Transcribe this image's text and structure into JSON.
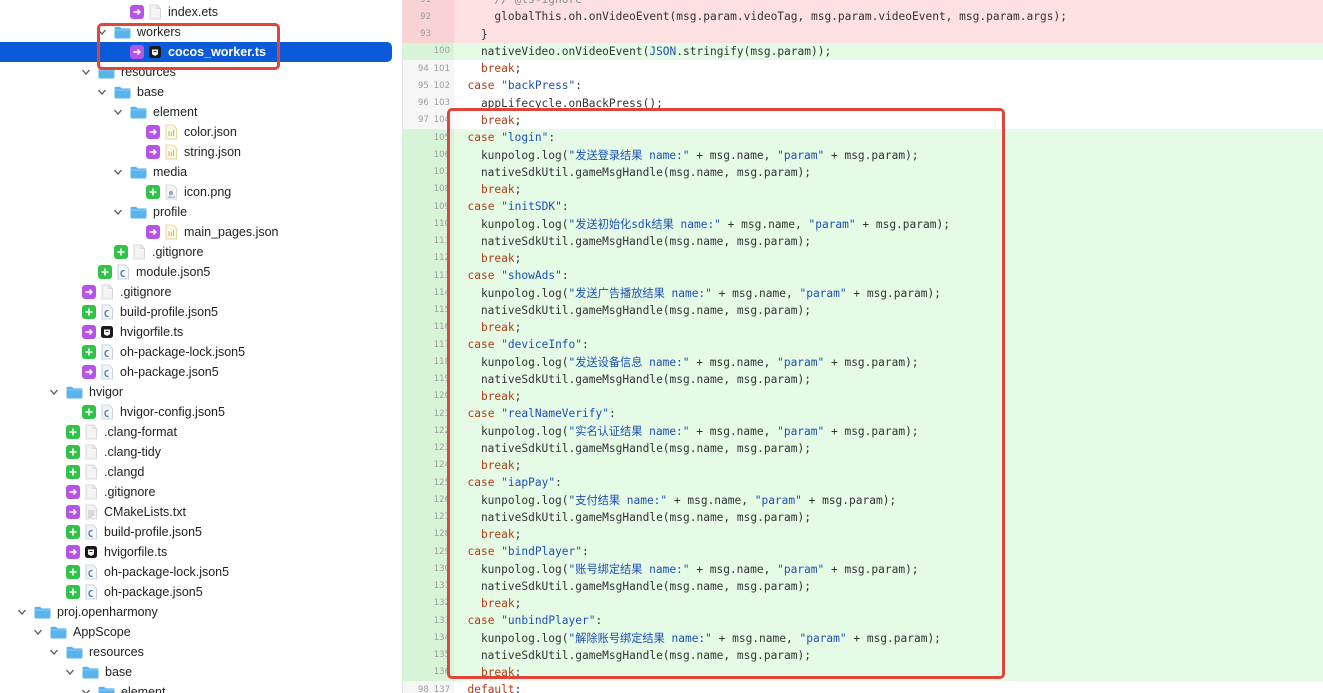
{
  "tree": [
    {
      "indent": 6,
      "chevron": "none",
      "badge": "mod",
      "icon": "file",
      "label": "index.ets"
    },
    {
      "indent": 5,
      "chevron": "open",
      "badge": "none",
      "icon": "folder",
      "label": "workers"
    },
    {
      "indent": 6,
      "chevron": "none",
      "badge": "mod",
      "icon": "ts-dark",
      "label": "cocos_worker.ts",
      "selected": true
    },
    {
      "indent": 4,
      "chevron": "open",
      "badge": "none",
      "icon": "folder",
      "label": "resources"
    },
    {
      "indent": 5,
      "chevron": "open",
      "badge": "none",
      "icon": "folder",
      "label": "base"
    },
    {
      "indent": 6,
      "chevron": "open",
      "badge": "none",
      "icon": "folder",
      "label": "element"
    },
    {
      "indent": 7,
      "chevron": "none",
      "badge": "mod",
      "icon": "json",
      "label": "color.json"
    },
    {
      "indent": 7,
      "chevron": "none",
      "badge": "mod",
      "icon": "json",
      "label": "string.json"
    },
    {
      "indent": 6,
      "chevron": "open",
      "badge": "none",
      "icon": "folder",
      "label": "media"
    },
    {
      "indent": 7,
      "chevron": "none",
      "badge": "add",
      "icon": "png",
      "label": "icon.png"
    },
    {
      "indent": 6,
      "chevron": "open",
      "badge": "none",
      "icon": "folder",
      "label": "profile"
    },
    {
      "indent": 7,
      "chevron": "none",
      "badge": "mod",
      "icon": "json",
      "label": "main_pages.json"
    },
    {
      "indent": 5,
      "chevron": "none",
      "badge": "add",
      "icon": "file",
      "label": ".gitignore"
    },
    {
      "indent": 4,
      "chevron": "none",
      "badge": "add",
      "icon": "json5",
      "label": "module.json5"
    },
    {
      "indent": 3,
      "chevron": "none",
      "badge": "mod",
      "icon": "file",
      "label": ".gitignore"
    },
    {
      "indent": 3,
      "chevron": "none",
      "badge": "add",
      "icon": "json5",
      "label": "build-profile.json5"
    },
    {
      "indent": 3,
      "chevron": "none",
      "badge": "mod",
      "icon": "ts-dark",
      "label": "hvigorfile.ts"
    },
    {
      "indent": 3,
      "chevron": "none",
      "badge": "add",
      "icon": "json5",
      "label": "oh-package-lock.json5"
    },
    {
      "indent": 3,
      "chevron": "none",
      "badge": "mod",
      "icon": "json5",
      "label": "oh-package.json5"
    },
    {
      "indent": 2,
      "chevron": "open",
      "badge": "none",
      "icon": "folder",
      "label": "hvigor"
    },
    {
      "indent": 3,
      "chevron": "none",
      "badge": "add",
      "icon": "json5",
      "label": "hvigor-config.json5"
    },
    {
      "indent": 2,
      "chevron": "none",
      "badge": "add",
      "icon": "file",
      "label": ".clang-format"
    },
    {
      "indent": 2,
      "chevron": "none",
      "badge": "add",
      "icon": "file",
      "label": ".clang-tidy"
    },
    {
      "indent": 2,
      "chevron": "none",
      "badge": "add",
      "icon": "file",
      "label": ".clangd"
    },
    {
      "indent": 2,
      "chevron": "none",
      "badge": "mod",
      "icon": "file",
      "label": ".gitignore"
    },
    {
      "indent": 2,
      "chevron": "none",
      "badge": "mod",
      "icon": "txt",
      "label": "CMakeLists.txt"
    },
    {
      "indent": 2,
      "chevron": "none",
      "badge": "add",
      "icon": "json5",
      "label": "build-profile.json5"
    },
    {
      "indent": 2,
      "chevron": "none",
      "badge": "mod",
      "icon": "ts-dark",
      "label": "hvigorfile.ts"
    },
    {
      "indent": 2,
      "chevron": "none",
      "badge": "add",
      "icon": "json5",
      "label": "oh-package-lock.json5"
    },
    {
      "indent": 2,
      "chevron": "none",
      "badge": "add",
      "icon": "json5",
      "label": "oh-package.json5"
    },
    {
      "indent": 0,
      "chevron": "open",
      "badge": "none",
      "icon": "folder",
      "label": "proj.openharmony"
    },
    {
      "indent": 1,
      "chevron": "open",
      "badge": "none",
      "icon": "folder",
      "label": "AppScope"
    },
    {
      "indent": 2,
      "chevron": "open",
      "badge": "none",
      "icon": "folder",
      "label": "resources"
    },
    {
      "indent": 3,
      "chevron": "open",
      "badge": "none",
      "icon": "folder",
      "label": "base"
    },
    {
      "indent": 4,
      "chevron": "open",
      "badge": "none",
      "icon": "folder",
      "label": "element"
    }
  ],
  "code": [
    {
      "type": "del",
      "old": "91",
      "new": "",
      "tokens": [
        [
          "      ",
          ""
        ],
        [
          "// @ts-ignore",
          "cm"
        ]
      ]
    },
    {
      "type": "del",
      "old": "92",
      "new": "",
      "tokens": [
        [
          "      globalThis.oh.onVideoEvent(msg.param.videoTag, msg.param.videoEvent, msg.param.args);",
          ""
        ]
      ]
    },
    {
      "type": "del",
      "old": "93",
      "new": "",
      "tokens": [
        [
          "    }",
          ""
        ]
      ]
    },
    {
      "type": "add",
      "old": "",
      "new": "100",
      "tokens": [
        [
          "    nativeVideo.onVideoEvent(",
          ""
        ],
        [
          "JSON",
          "blue"
        ],
        [
          ".stringify(msg.param));",
          ""
        ]
      ]
    },
    {
      "type": "ctx",
      "old": "94",
      "new": "101",
      "tokens": [
        [
          "    ",
          ""
        ],
        [
          "break",
          "kw"
        ],
        [
          ";",
          ""
        ]
      ]
    },
    {
      "type": "ctx",
      "old": "95",
      "new": "102",
      "tokens": [
        [
          "  ",
          ""
        ],
        [
          "case",
          "kw"
        ],
        [
          " ",
          ""
        ],
        [
          "\"backPress\"",
          "str"
        ],
        [
          ":",
          ""
        ]
      ]
    },
    {
      "type": "ctx",
      "old": "96",
      "new": "103",
      "tokens": [
        [
          "    appLifecycle.onBackPress();",
          ""
        ]
      ]
    },
    {
      "type": "ctx",
      "old": "97",
      "new": "104",
      "tokens": [
        [
          "    ",
          ""
        ],
        [
          "break",
          "kw"
        ],
        [
          ";",
          ""
        ]
      ]
    },
    {
      "type": "add",
      "old": "",
      "new": "105",
      "tokens": [
        [
          "  ",
          ""
        ],
        [
          "case",
          "kw"
        ],
        [
          " ",
          ""
        ],
        [
          "\"login\"",
          "str"
        ],
        [
          ":",
          ""
        ]
      ]
    },
    {
      "type": "add",
      "old": "",
      "new": "106",
      "tokens": [
        [
          "    kunpolog.log(",
          ""
        ],
        [
          "\"发送登录结果 name:\"",
          "str"
        ],
        [
          " + msg.name, ",
          ""
        ],
        [
          "\"param\"",
          "str"
        ],
        [
          " + msg.param);",
          ""
        ]
      ]
    },
    {
      "type": "add",
      "old": "",
      "new": "107",
      "tokens": [
        [
          "    nativeSdkUtil.gameMsgHandle(msg.name, msg.param);",
          ""
        ]
      ]
    },
    {
      "type": "add",
      "old": "",
      "new": "108",
      "tokens": [
        [
          "    ",
          ""
        ],
        [
          "break",
          "kw"
        ],
        [
          ";",
          ""
        ]
      ]
    },
    {
      "type": "add",
      "old": "",
      "new": "109",
      "tokens": [
        [
          "  ",
          ""
        ],
        [
          "case",
          "kw"
        ],
        [
          " ",
          ""
        ],
        [
          "\"initSDK\"",
          "str"
        ],
        [
          ":",
          ""
        ]
      ]
    },
    {
      "type": "add",
      "old": "",
      "new": "110",
      "tokens": [
        [
          "    kunpolog.log(",
          ""
        ],
        [
          "\"发送初始化sdk结果 name:\"",
          "str"
        ],
        [
          " + msg.name, ",
          ""
        ],
        [
          "\"param\"",
          "str"
        ],
        [
          " + msg.param);",
          ""
        ]
      ]
    },
    {
      "type": "add",
      "old": "",
      "new": "111",
      "tokens": [
        [
          "    nativeSdkUtil.gameMsgHandle(msg.name, msg.param);",
          ""
        ]
      ]
    },
    {
      "type": "add",
      "old": "",
      "new": "112",
      "tokens": [
        [
          "    ",
          ""
        ],
        [
          "break",
          "kw"
        ],
        [
          ";",
          ""
        ]
      ]
    },
    {
      "type": "add",
      "old": "",
      "new": "113",
      "tokens": [
        [
          "  ",
          ""
        ],
        [
          "case",
          "kw"
        ],
        [
          " ",
          ""
        ],
        [
          "\"showAds\"",
          "str"
        ],
        [
          ":",
          ""
        ]
      ]
    },
    {
      "type": "add",
      "old": "",
      "new": "114",
      "tokens": [
        [
          "    kunpolog.log(",
          ""
        ],
        [
          "\"发送广告播放结果 name:\"",
          "str"
        ],
        [
          " + msg.name, ",
          ""
        ],
        [
          "\"param\"",
          "str"
        ],
        [
          " + msg.param);",
          ""
        ]
      ]
    },
    {
      "type": "add",
      "old": "",
      "new": "115",
      "tokens": [
        [
          "    nativeSdkUtil.gameMsgHandle(msg.name, msg.param);",
          ""
        ]
      ]
    },
    {
      "type": "add",
      "old": "",
      "new": "116",
      "tokens": [
        [
          "    ",
          ""
        ],
        [
          "break",
          "kw"
        ],
        [
          ";",
          ""
        ]
      ]
    },
    {
      "type": "add",
      "old": "",
      "new": "117",
      "tokens": [
        [
          "  ",
          ""
        ],
        [
          "case",
          "kw"
        ],
        [
          " ",
          ""
        ],
        [
          "\"deviceInfo\"",
          "str"
        ],
        [
          ":",
          ""
        ]
      ]
    },
    {
      "type": "add",
      "old": "",
      "new": "118",
      "tokens": [
        [
          "    kunpolog.log(",
          ""
        ],
        [
          "\"发送设备信息 name:\"",
          "str"
        ],
        [
          " + msg.name, ",
          ""
        ],
        [
          "\"param\"",
          "str"
        ],
        [
          " + msg.param);",
          ""
        ]
      ]
    },
    {
      "type": "add",
      "old": "",
      "new": "119",
      "tokens": [
        [
          "    nativeSdkUtil.gameMsgHandle(msg.name, msg.param);",
          ""
        ]
      ]
    },
    {
      "type": "add",
      "old": "",
      "new": "120",
      "tokens": [
        [
          "    ",
          ""
        ],
        [
          "break",
          "kw"
        ],
        [
          ";",
          ""
        ]
      ]
    },
    {
      "type": "add",
      "old": "",
      "new": "121",
      "tokens": [
        [
          "  ",
          ""
        ],
        [
          "case",
          "kw"
        ],
        [
          " ",
          ""
        ],
        [
          "\"realNameVerify\"",
          "str"
        ],
        [
          ":",
          ""
        ]
      ]
    },
    {
      "type": "add",
      "old": "",
      "new": "122",
      "tokens": [
        [
          "    kunpolog.log(",
          ""
        ],
        [
          "\"实名认证结果 name:\"",
          "str"
        ],
        [
          " + msg.name, ",
          ""
        ],
        [
          "\"param\"",
          "str"
        ],
        [
          " + msg.param);",
          ""
        ]
      ]
    },
    {
      "type": "add",
      "old": "",
      "new": "123",
      "tokens": [
        [
          "    nativeSdkUtil.gameMsgHandle(msg.name, msg.param);",
          ""
        ]
      ]
    },
    {
      "type": "add",
      "old": "",
      "new": "124",
      "tokens": [
        [
          "    ",
          ""
        ],
        [
          "break",
          "kw"
        ],
        [
          ";",
          ""
        ]
      ]
    },
    {
      "type": "add",
      "old": "",
      "new": "125",
      "tokens": [
        [
          "  ",
          ""
        ],
        [
          "case",
          "kw"
        ],
        [
          " ",
          ""
        ],
        [
          "\"iapPay\"",
          "str"
        ],
        [
          ":",
          ""
        ]
      ]
    },
    {
      "type": "add",
      "old": "",
      "new": "126",
      "tokens": [
        [
          "    kunpolog.log(",
          ""
        ],
        [
          "\"支付结果 name:\"",
          "str"
        ],
        [
          " + msg.name, ",
          ""
        ],
        [
          "\"param\"",
          "str"
        ],
        [
          " + msg.param);",
          ""
        ]
      ]
    },
    {
      "type": "add",
      "old": "",
      "new": "127",
      "tokens": [
        [
          "    nativeSdkUtil.gameMsgHandle(msg.name, msg.param);",
          ""
        ]
      ]
    },
    {
      "type": "add",
      "old": "",
      "new": "128",
      "tokens": [
        [
          "    ",
          ""
        ],
        [
          "break",
          "kw"
        ],
        [
          ";",
          ""
        ]
      ]
    },
    {
      "type": "add",
      "old": "",
      "new": "129",
      "tokens": [
        [
          "  ",
          ""
        ],
        [
          "case",
          "kw"
        ],
        [
          " ",
          ""
        ],
        [
          "\"bindPlayer\"",
          "str"
        ],
        [
          ":",
          ""
        ]
      ]
    },
    {
      "type": "add",
      "old": "",
      "new": "130",
      "tokens": [
        [
          "    kunpolog.log(",
          ""
        ],
        [
          "\"账号绑定结果 name:\"",
          "str"
        ],
        [
          " + msg.name, ",
          ""
        ],
        [
          "\"param\"",
          "str"
        ],
        [
          " + msg.param);",
          ""
        ]
      ]
    },
    {
      "type": "add",
      "old": "",
      "new": "131",
      "tokens": [
        [
          "    nativeSdkUtil.gameMsgHandle(msg.name, msg.param);",
          ""
        ]
      ]
    },
    {
      "type": "add",
      "old": "",
      "new": "132",
      "tokens": [
        [
          "    ",
          ""
        ],
        [
          "break",
          "kw"
        ],
        [
          ";",
          ""
        ]
      ]
    },
    {
      "type": "add",
      "old": "",
      "new": "133",
      "tokens": [
        [
          "  ",
          ""
        ],
        [
          "case",
          "kw"
        ],
        [
          " ",
          ""
        ],
        [
          "\"unbindPlayer\"",
          "str"
        ],
        [
          ":",
          ""
        ]
      ]
    },
    {
      "type": "add",
      "old": "",
      "new": "134",
      "tokens": [
        [
          "    kunpolog.log(",
          ""
        ],
        [
          "\"解除账号绑定结果 name:\"",
          "str"
        ],
        [
          " + msg.name, ",
          ""
        ],
        [
          "\"param\"",
          "str"
        ],
        [
          " + msg.param);",
          ""
        ]
      ]
    },
    {
      "type": "add",
      "old": "",
      "new": "135",
      "tokens": [
        [
          "    nativeSdkUtil.gameMsgHandle(msg.name, msg.param);",
          ""
        ]
      ]
    },
    {
      "type": "add",
      "old": "",
      "new": "136",
      "tokens": [
        [
          "    ",
          ""
        ],
        [
          "break",
          "kw"
        ],
        [
          ";",
          ""
        ]
      ]
    },
    {
      "type": "ctx",
      "old": "98",
      "new": "137",
      "tokens": [
        [
          "  ",
          ""
        ],
        [
          "default",
          "kw"
        ],
        [
          ":",
          ""
        ]
      ]
    }
  ],
  "colors": {
    "selection": "#0a5ad9",
    "badge_added": "#30c24a",
    "badge_modified": "#b654e6",
    "folder": "#5ab4ec",
    "diff_added": "#e6fbe6",
    "diff_deleted": "#fde0e0",
    "highlight_box": "#e0453c"
  }
}
